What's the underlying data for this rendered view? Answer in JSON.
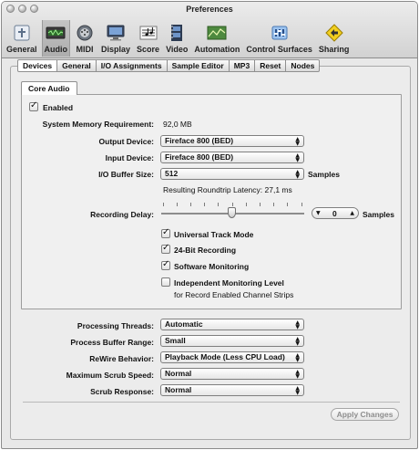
{
  "window": {
    "title": "Preferences"
  },
  "toolbar": {
    "items": [
      {
        "label": "General",
        "icon": "general-icon"
      },
      {
        "label": "Audio",
        "icon": "audio-icon",
        "selected": true
      },
      {
        "label": "MIDI",
        "icon": "midi-icon"
      },
      {
        "label": "Display",
        "icon": "display-icon"
      },
      {
        "label": "Score",
        "icon": "score-icon"
      },
      {
        "label": "Video",
        "icon": "video-icon"
      },
      {
        "label": "Automation",
        "icon": "automation-icon"
      },
      {
        "label": "Control Surfaces",
        "icon": "control-surfaces-icon"
      },
      {
        "label": "Sharing",
        "icon": "sharing-icon"
      }
    ]
  },
  "tabs": [
    {
      "label": "Devices",
      "selected": true
    },
    {
      "label": "General"
    },
    {
      "label": "I/O Assignments"
    },
    {
      "label": "Sample Editor"
    },
    {
      "label": "MP3"
    },
    {
      "label": "Reset"
    },
    {
      "label": "Nodes"
    }
  ],
  "core_audio": {
    "tab_label": "Core Audio",
    "enabled": {
      "label": "Enabled",
      "checked": true
    },
    "memory": {
      "label": "System Memory Requirement:",
      "value": "92,0 MB"
    },
    "output_device": {
      "label": "Output Device:",
      "value": "Fireface 800 (BED)"
    },
    "input_device": {
      "label": "Input Device:",
      "value": "Fireface 800 (BED)"
    },
    "buffer_size": {
      "label": "I/O Buffer Size:",
      "value": "512",
      "unit": "Samples"
    },
    "latency": "Resulting Roundtrip Latency: 27,1 ms",
    "recording_delay": {
      "label": "Recording Delay:",
      "value": "0",
      "unit": "Samples",
      "slider_level": 0.5
    },
    "checkboxes": [
      {
        "label": "Universal Track Mode",
        "checked": true
      },
      {
        "label": "24-Bit Recording",
        "checked": true
      },
      {
        "label": "Software Monitoring",
        "checked": true
      },
      {
        "label": "Independent Monitoring Level",
        "sub": "for Record Enabled Channel Strips",
        "checked": false
      }
    ]
  },
  "bottom": {
    "processing_threads": {
      "label": "Processing Threads:",
      "value": "Automatic"
    },
    "process_buffer": {
      "label": "Process Buffer Range:",
      "value": "Small"
    },
    "rewire": {
      "label": "ReWire Behavior:",
      "value": "Playback Mode (Less CPU Load)"
    },
    "scrub_speed": {
      "label": "Maximum Scrub Speed:",
      "value": "Normal"
    },
    "scrub_response": {
      "label": "Scrub Response:",
      "value": "Normal"
    }
  },
  "apply_label": "Apply Changes",
  "colors": {
    "toolbar_bg": "#d2d2d2",
    "window_bg": "#e8e8e8"
  }
}
